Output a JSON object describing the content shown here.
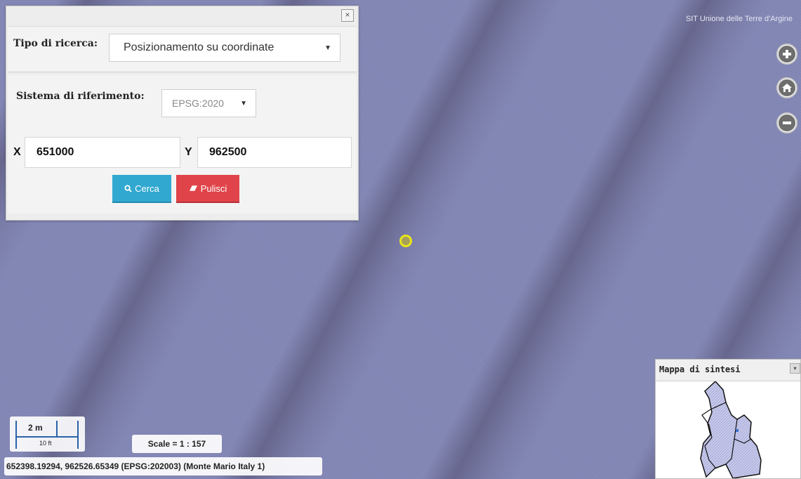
{
  "map": {
    "attribution": "SIT Unione delle Terre d'Argine",
    "controls": {
      "zoom_in_icon": "plus-circle-icon",
      "home_icon": "home-icon",
      "zoom_out_icon": "minus-circle-icon"
    },
    "marker_color": "#e8e51a"
  },
  "search_panel": {
    "close_label": "×",
    "search_type_label": "Tipo di ricerca:",
    "search_type_value": "Posizionamento su coordinate",
    "reference_system_label": "Sistema di riferimento:",
    "reference_system_value": "EPSG:2020",
    "x_label": "X",
    "x_value": "651000",
    "y_label": "Y",
    "y_value": "962500",
    "search_button": "Cerca",
    "clear_button": "Pulisci",
    "colors": {
      "search_button": "#31a8d0",
      "clear_button": "#e0444a"
    }
  },
  "overview_map": {
    "title": "Mappa di sintesi",
    "toggle_label": "▾"
  },
  "scale_line": {
    "top_label": "2 m",
    "bottom_label": "10 ft"
  },
  "scale_text": "Scale = 1 : 157",
  "mouse_position": "652398.19294, 962526.65349 (EPSG:202003) (Monte Mario Italy 1)"
}
